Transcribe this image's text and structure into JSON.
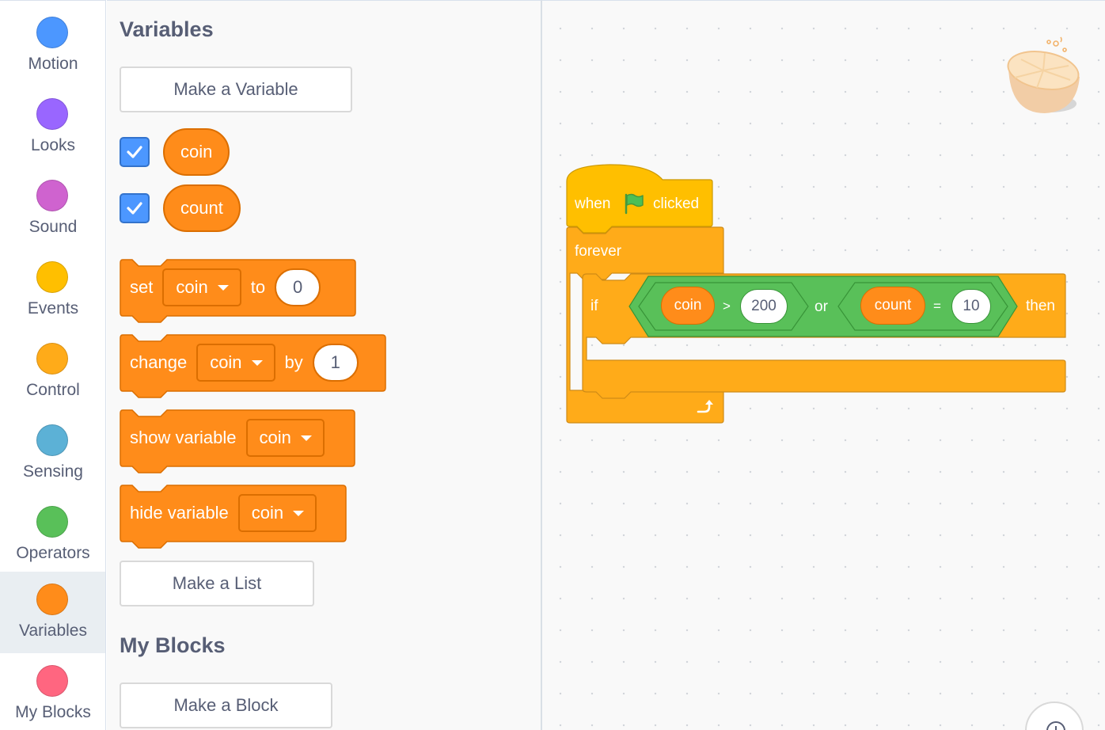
{
  "categories": [
    {
      "label": "Motion",
      "color": "#4c97ff"
    },
    {
      "label": "Looks",
      "color": "#9966ff"
    },
    {
      "label": "Sound",
      "color": "#cf63cf"
    },
    {
      "label": "Events",
      "color": "#ffbf00"
    },
    {
      "label": "Control",
      "color": "#ffab19"
    },
    {
      "label": "Sensing",
      "color": "#5cb1d6"
    },
    {
      "label": "Operators",
      "color": "#59c059"
    },
    {
      "label": "Variables",
      "color": "#ff8c1a"
    },
    {
      "label": "My Blocks",
      "color": "#ff6680"
    }
  ],
  "selected_category": "Variables",
  "palette": {
    "variables_title": "Variables",
    "make_variable_button": "Make a Variable",
    "variables": [
      {
        "name": "coin",
        "checked": true
      },
      {
        "name": "count",
        "checked": true
      }
    ],
    "set_block": {
      "set": "set",
      "var": "coin",
      "to": "to",
      "value": "0"
    },
    "change_block": {
      "change": "change",
      "var": "coin",
      "by": "by",
      "value": "1"
    },
    "show_block": {
      "label": "show variable",
      "var": "coin"
    },
    "hide_block": {
      "label": "hide variable",
      "var": "coin"
    },
    "make_list_button": "Make a List",
    "myblocks_title": "My Blocks",
    "make_block_button": "Make a Block"
  },
  "script": {
    "hat": {
      "when": "when",
      "clicked": "clicked",
      "icon": "green-flag-icon"
    },
    "forever": "forever",
    "if_block": {
      "if": "if",
      "then": "then",
      "left_compare": {
        "var": "coin",
        "op": ">",
        "value": "200"
      },
      "or": "or",
      "right_compare": {
        "var": "count",
        "op": "=",
        "value": "10"
      }
    },
    "loop_icon": "loop-arrow-icon"
  },
  "colors": {
    "variables_block": "#ff8c1a",
    "events_block": "#ffbf00",
    "control_block": "#ffab19",
    "operators_block": "#59c059"
  }
}
